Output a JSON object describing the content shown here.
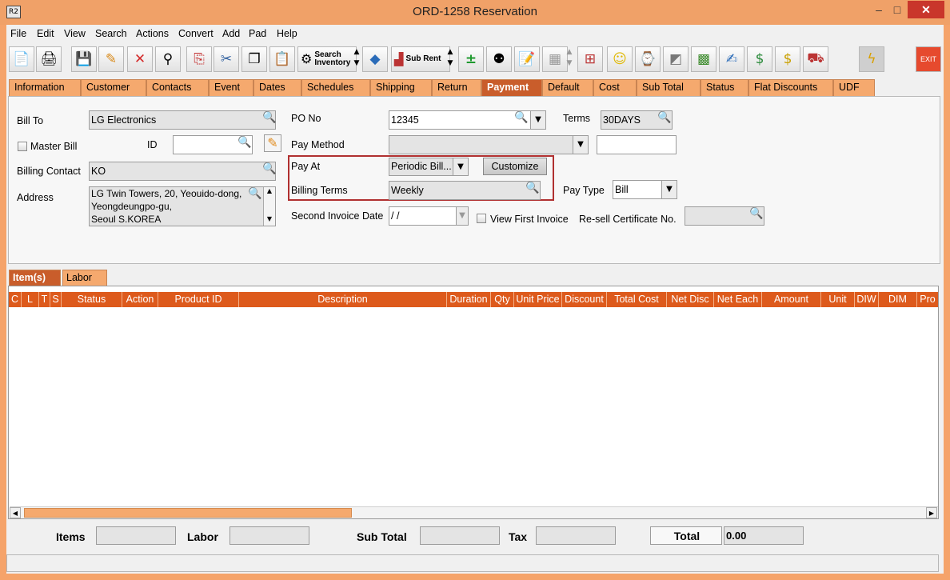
{
  "window": {
    "title": "ORD-1258 Reservation",
    "app_icon": "R2",
    "minimize": "–",
    "maximize": "□",
    "close": "✕"
  },
  "menu": [
    "File",
    "Edit",
    "View",
    "Search",
    "Actions",
    "Convert",
    "Add",
    "Pad",
    "Help"
  ],
  "toolbar": {
    "search_inventory_line1": "Search",
    "search_inventory_line2": "Inventory",
    "sub_rent": "Sub Rent",
    "exit": "EXIT"
  },
  "tabs": [
    "Information",
    "Customer",
    "Contacts",
    "Event",
    "Dates",
    "Schedules",
    "Shipping",
    "Return",
    "Payment",
    "Default",
    "Cost",
    "Sub Total",
    "Status",
    "Flat Discounts",
    "UDF"
  ],
  "active_tab": "Payment",
  "form": {
    "bill_to_label": "Bill To",
    "bill_to_value": "LG Electronics",
    "master_bill_label": "Master Bill",
    "id_label": "ID",
    "id_value": "",
    "billing_contact_label": "Billing Contact",
    "billing_contact_value": "KO",
    "address_label": "Address",
    "address_line1": "LG Twin Towers, 20, Yeouido-dong,",
    "address_line2": "Yeongdeungpo-gu,",
    "address_line3": "Seoul S.KOREA",
    "po_no_label": "PO No",
    "po_no_value": "12345",
    "terms_label": "Terms",
    "terms_value": "30DAYS",
    "pay_method_label": "Pay Method",
    "pay_method_value": "",
    "pay_method_extra": "",
    "pay_at_label": "Pay At",
    "pay_at_value": "Periodic Bill...",
    "customize_label": "Customize",
    "billing_terms_label": "Billing Terms",
    "billing_terms_value": "Weekly",
    "pay_type_label": "Pay Type",
    "pay_type_value": "Bill",
    "second_invoice_label": "Second Invoice Date",
    "second_invoice_value": " / /",
    "view_first_invoice_label": "View First Invoice",
    "resell_label": "Re-sell Certificate No.",
    "resell_value": ""
  },
  "item_tabs": [
    "Item(s)",
    "Labor"
  ],
  "grid_columns": [
    "C",
    "L",
    "T",
    "S",
    "Status",
    "Action",
    "Product ID",
    "Description",
    "Duration",
    "Qty",
    "Unit Price",
    "Discount",
    "Total Cost",
    "Net Disc",
    "Net Each",
    "Amount",
    "Unit",
    "DIW",
    "DIM",
    "Pro"
  ],
  "totals": {
    "items_label": "Items",
    "items_value": "",
    "labor_label": "Labor",
    "labor_value": "",
    "subtotal_label": "Sub Total",
    "subtotal_value": "",
    "tax_label": "Tax",
    "tax_value": "",
    "total_label": "Total",
    "total_value": "0.00"
  },
  "colors": {
    "accent": "#f5a36a",
    "active_tab": "#c95d2b",
    "grid_header": "#dd5a1c",
    "highlight": "#b03030"
  }
}
